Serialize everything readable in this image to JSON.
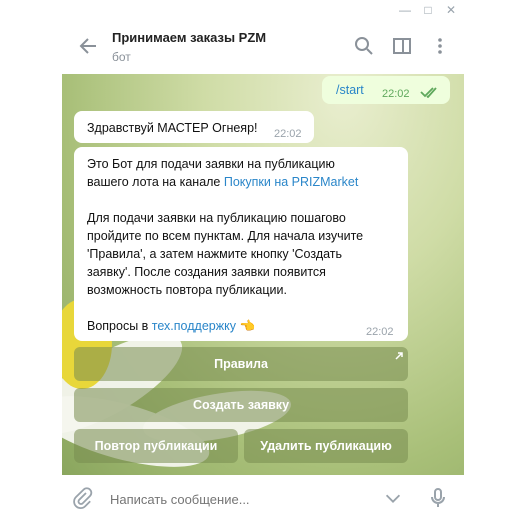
{
  "chat": {
    "title": "Принимаем заказы PZM",
    "status": "бот"
  },
  "messages": {
    "out_text": "/start",
    "out_time": "22:02",
    "greeting_text": "Здравствуй МАСТЕР Огнеяр!",
    "greeting_time": "22:02",
    "info_line1": "Это Бот для подачи заявки на публикацию",
    "info_line2_pre": "вашего лота на канале ",
    "info_line2_link": "Покупки на PRIZMarket",
    "info_para2_l1": "Для подачи заявки на публикацию пошагово",
    "info_para2_l2": "пройдите по всем пунктам. Для начала изучите",
    "info_para2_l3": "'Правила', а затем нажмите кнопку 'Создать",
    "info_para2_l4": "заявку'. После создания заявки появится",
    "info_para2_l5": "возможность повтора публикации.",
    "info_para3_pre": "Вопросы в ",
    "info_para3_link": "тех.поддержку",
    "info_para3_emoji": "👈",
    "info_time": "22:02"
  },
  "keyboard": {
    "rules": "Правила",
    "create": "Создать заявку",
    "repeat": "Повтор публикации",
    "delete": "Удалить публикацию"
  },
  "composer": {
    "placeholder": "Написать сообщение..."
  },
  "icons": [
    "arrow-back-icon",
    "search-icon",
    "sidebar-icon",
    "more-vert-icon",
    "attach-icon",
    "chevron-down-icon",
    "mic-icon",
    "minimize-icon",
    "maximize-icon",
    "close-icon",
    "double-check-icon",
    "external-arrow-icon"
  ],
  "colors": {
    "accent": "#2a86c9",
    "outgoing": "#effedd",
    "check": "#5fa85c"
  }
}
